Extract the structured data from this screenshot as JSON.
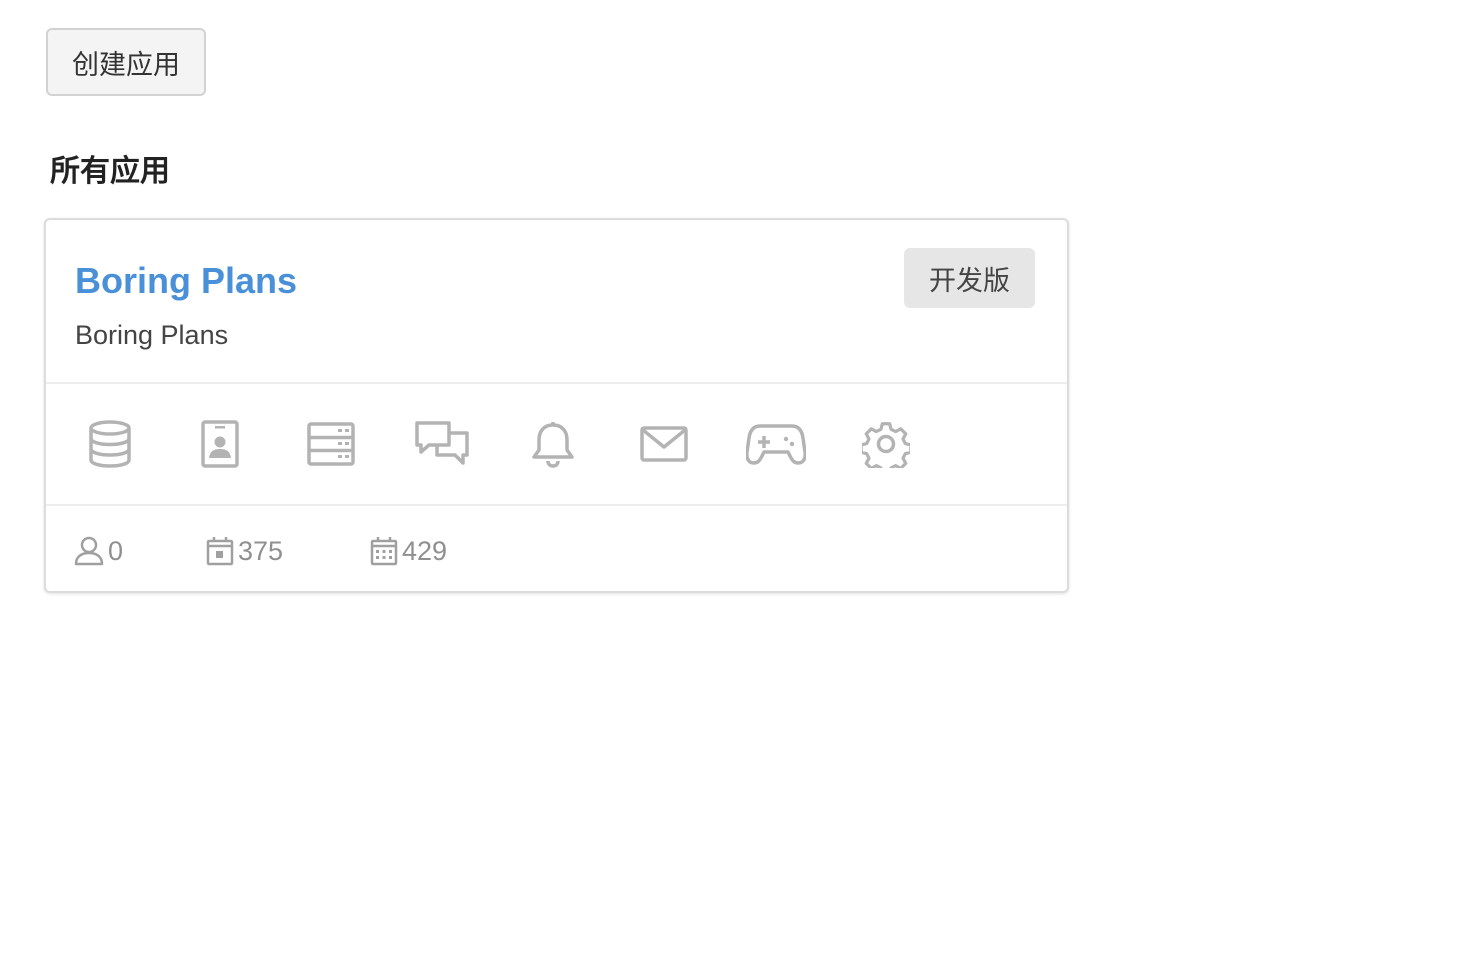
{
  "toolbar": {
    "create_label": "创建应用"
  },
  "section": {
    "title": "所有应用"
  },
  "apps": [
    {
      "name": "Boring Plans",
      "description": "Boring Plans",
      "version_badge": "开发版",
      "services": [
        {
          "icon": "database-icon"
        },
        {
          "icon": "contact-card-icon"
        },
        {
          "icon": "server-icon"
        },
        {
          "icon": "chat-bubbles-icon"
        },
        {
          "icon": "bell-icon"
        },
        {
          "icon": "envelope-icon"
        },
        {
          "icon": "gamepad-icon"
        },
        {
          "icon": "gear-icon"
        }
      ],
      "stats": {
        "users": "0",
        "daily": "375",
        "monthly": "429"
      }
    }
  ],
  "colors": {
    "accent": "#4a90d9",
    "icon_gray": "#b3b3b3",
    "stat_gray": "#8f8f8f",
    "badge_bg": "#e6e6e6"
  }
}
